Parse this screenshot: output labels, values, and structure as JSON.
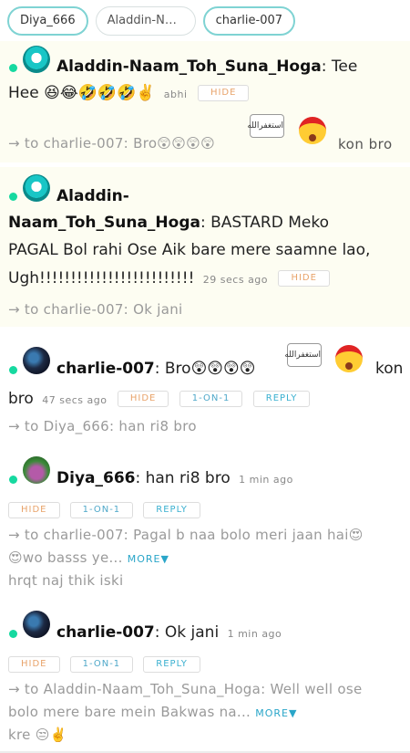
{
  "tabs": [
    "Diya_666",
    "Aladdin-Naam_Toh_Suna_Hoga",
    "charlie-007"
  ],
  "buttons": {
    "hide": "HIDE",
    "one_on_one": "1-ON-1",
    "reply": "REPLY",
    "more": "MORE▼"
  },
  "colors": {
    "online_dot": "#16d9a0",
    "accent": "#7fd3d3",
    "hide": "#e8a36a",
    "reply": "#3ab0d0"
  },
  "messages": [
    {
      "user": "Aladdin-Naam_Toh_Suna_Hoga",
      "text_a": ": Tee",
      "text_b": "Hee 😆😂🤣🤣🤣✌️",
      "time": "abhi",
      "reply_to": "→ to charlie-007: Bro😲😲😲😲",
      "sticker_text": "استغفرالله",
      "trail": "kon bro"
    },
    {
      "user_a": "Aladdin-",
      "user_b": "Naam_Toh_Suna_Hoga",
      "text_a": ": BASTARD Meko",
      "text_b": "PAGAL Bol rahi Ose Aik bare mere saamne lao,",
      "text_c": "Ugh!!!!!!!!!!!!!!!!!!!!!!!!!",
      "time": "29 secs ago",
      "reply_to": "→ to charlie-007: Ok jani"
    },
    {
      "user": "charlie-007",
      "text_a": ": Bro😲😲😲😲",
      "sticker_text": "استغفرالله",
      "trail": "kon",
      "text_b": "bro",
      "time": "47 secs ago",
      "reply_to": "→ to Diya_666: han ri8 bro"
    },
    {
      "user": "Diya_666",
      "text_a": ": han ri8 bro",
      "time": "1 min ago",
      "reply_to_a": "→ to charlie-007: Pagal b naa bolo meri jaan hai😍",
      "reply_to_b": "😍wo basss ye...",
      "reply_to_c": "hrqt naj thik iski"
    },
    {
      "user": "charlie-007",
      "text_a": ": Ok jani",
      "time": "1 min ago",
      "reply_to_a": "→ to Aladdin-Naam_Toh_Suna_Hoga: Well well ose",
      "reply_to_b": "bolo mere bare mein Bakwas na...",
      "reply_to_c": "kre 😒✌️"
    }
  ]
}
